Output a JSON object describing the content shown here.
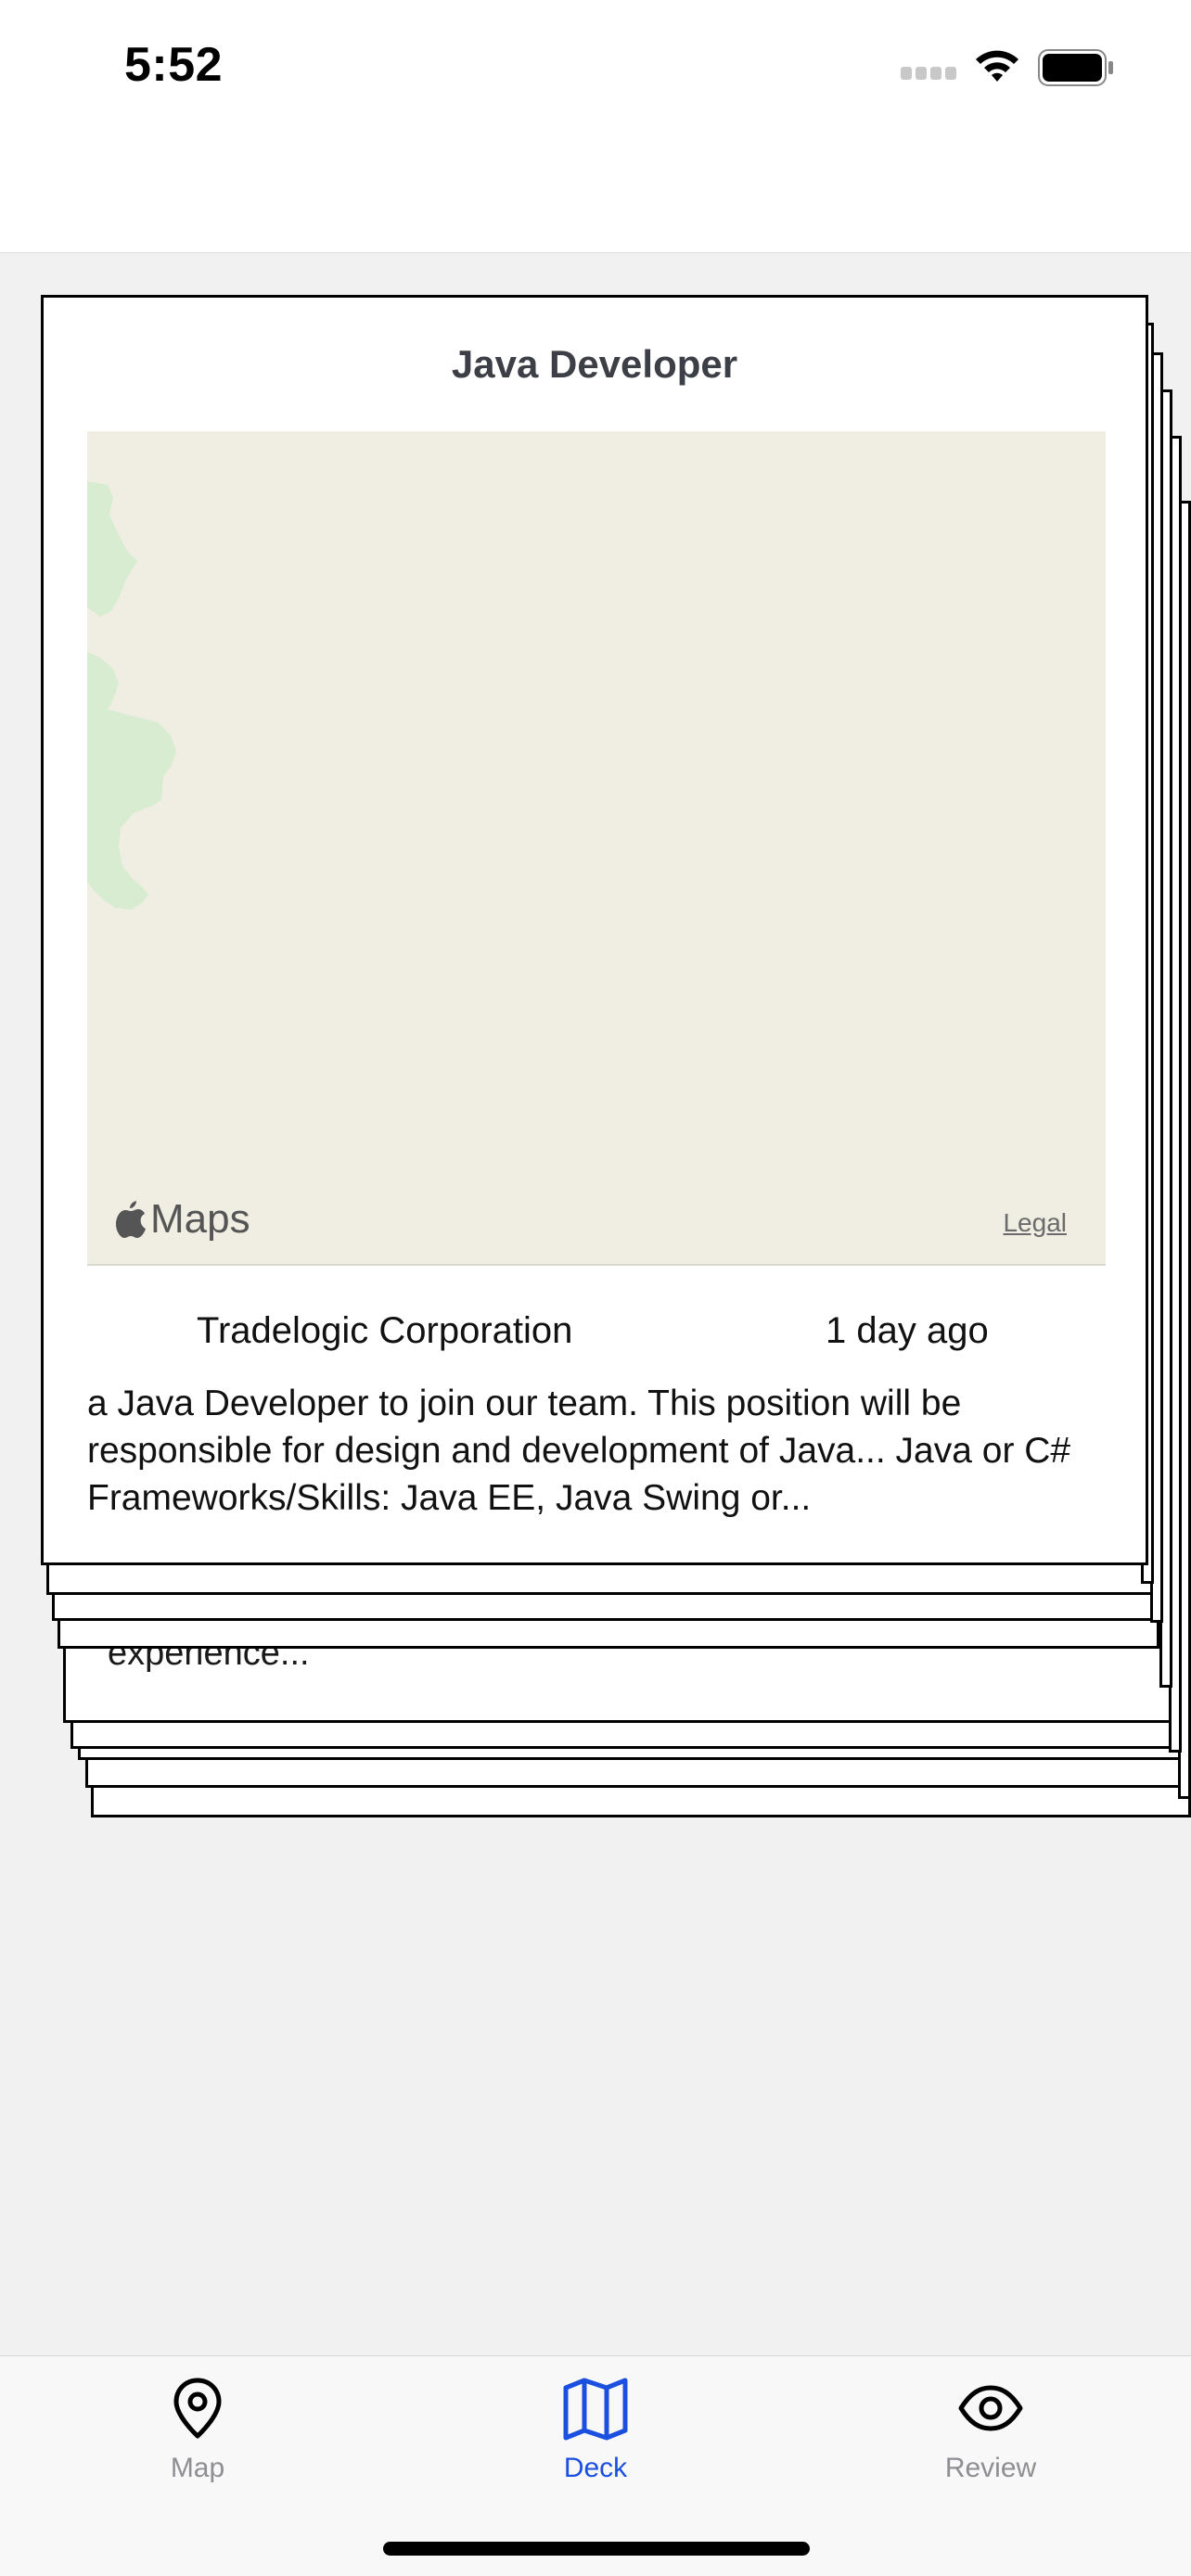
{
  "status_bar": {
    "time": "5:52",
    "icons": [
      "cellular-signal-icon",
      "wifi-icon",
      "battery-icon"
    ]
  },
  "card_stack": {
    "underlying_card_snippet": "experience...",
    "top_card": {
      "title": "Java Developer",
      "map": {
        "attribution": "Maps",
        "legal_link": "Legal"
      },
      "company": "Tradelogic Corporation",
      "posted": "1 day ago",
      "description": "a Java Developer to join our team. This position will be responsible for design and development of Java... Java or C# Frameworks/Skills: Java EE, Java Swing or..."
    }
  },
  "tab_bar": {
    "active_tab": "Deck",
    "tabs": [
      {
        "label": "Map",
        "icon": "map-pin-icon"
      },
      {
        "label": "Deck",
        "icon": "folded-map-icon"
      },
      {
        "label": "Review",
        "icon": "eye-icon"
      }
    ]
  },
  "colors": {
    "active_tab": "#1a4fe0",
    "inactive_tab": "#8e8e93",
    "background": "#f1f1f1",
    "map_background": "#f0eee2",
    "map_green": "#d7ecd0",
    "title_text": "#3c4046"
  }
}
